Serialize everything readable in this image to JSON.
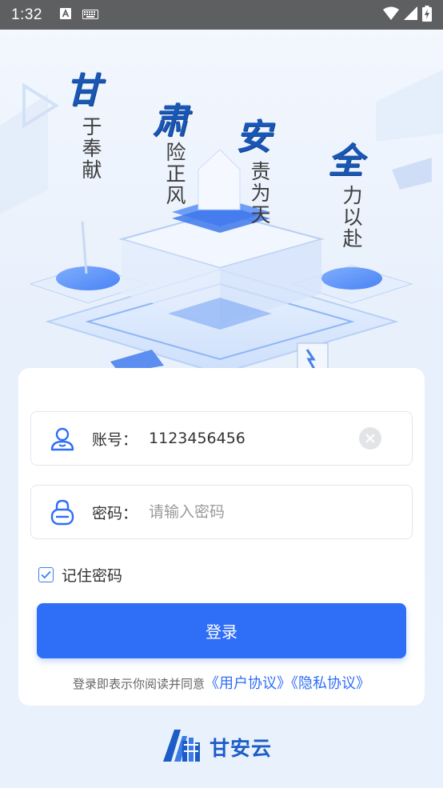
{
  "status_bar": {
    "time": "1:32"
  },
  "hero": {
    "calligraphy": [
      "甘",
      "肃",
      "安",
      "全"
    ],
    "slogans": [
      "于奉献",
      "险正风",
      "责为天",
      "力以赴"
    ]
  },
  "login": {
    "account_label": "账号：",
    "account_value": "1123456456",
    "password_label": "密码：",
    "password_placeholder": "请输入密码",
    "remember_label": "记住密码",
    "remember_checked": true,
    "submit_label": "登录",
    "agreement_prefix": "登录即表示你阅读并同意",
    "user_agreement": "《用户协议》",
    "privacy_policy": "《隐私协议》"
  },
  "brand": {
    "name": "甘安云"
  },
  "colors": {
    "primary": "#2f6ef6",
    "brand_text": "#1c5cc7",
    "calligraphy": "#1a57b5",
    "status_bar": "#5d5f61"
  }
}
